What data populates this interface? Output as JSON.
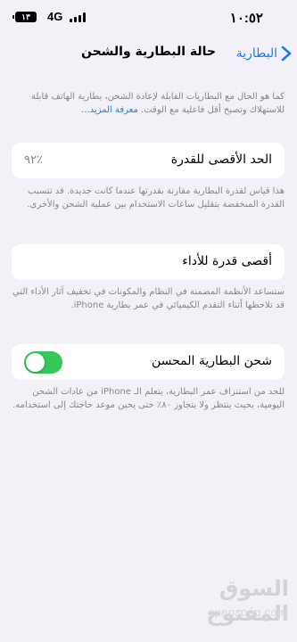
{
  "status_bar": {
    "time": "١٠:٥٢",
    "network": "4G",
    "battery": "١٣"
  },
  "nav": {
    "title": "حالة البطارية والشحن",
    "back_label": "البطارية"
  },
  "intro": {
    "text": "كما هو الحال مع البطاريات القابلة لإعادة الشحن، بطارية الهاتف قابلة للاستهلاك وتصبح أقل فاعلية مع الوقت.",
    "link": "معرفة المزيد..."
  },
  "max_capacity": {
    "label": "الحد الأقصى للقدرة",
    "value": "٩٢٪",
    "note": "هذا قياس لقدرة البطارية مقارنة بقدرتها عندما كانت جديدة. قد تتسبب القدرة المنخفضة بتقليل ساعات الاستخدام بين عملية الشحن والأخرى."
  },
  "peak_performance": {
    "label": "أقصى قدرة للأداء",
    "note": "ستساعد الأنظمة المضمنة في النظام والمكونات في تخفيف آثار الأداء التي قد تلاحظها أثناء التقدم الكيميائي في عمر بطارية iPhone."
  },
  "optimized_charging": {
    "label": "شحن البطارية المحسن",
    "enabled": true,
    "note": "للحد من استنزاف عمر البطارية، يتعلم الـ iPhone من عادات الشحن اليومية، بحيث ينتظر ولا يتجاوز ٨٠٪ حتى يحين موعد حاجتك إلى استخدامه."
  },
  "watermark": {
    "arabic": "السوق المفتوح",
    "latin": "opensooq.com"
  },
  "colors": {
    "accent": "#1a7cf4",
    "toggle_on": "#34c759",
    "background": "#f2f1f7"
  }
}
